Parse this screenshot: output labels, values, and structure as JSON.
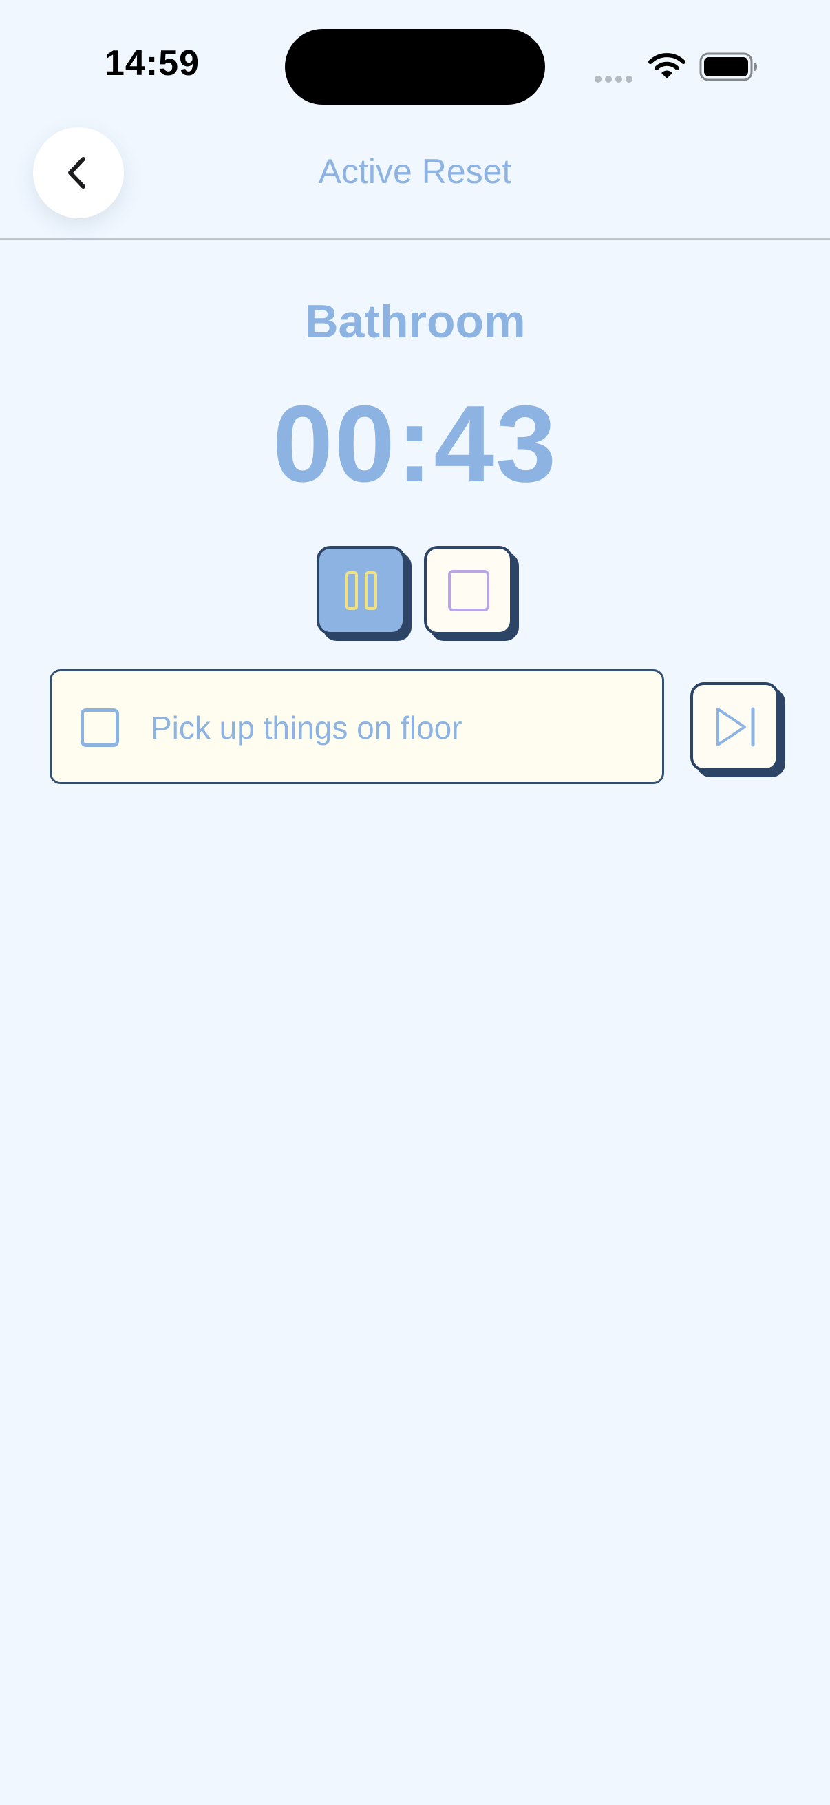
{
  "status_bar": {
    "time": "14:59"
  },
  "header": {
    "title": "Active Reset",
    "back_icon": "chevron-left-icon"
  },
  "session": {
    "room": "Bathroom",
    "timer": "00:43"
  },
  "controls": {
    "pause_icon": "pause-icon",
    "stop_icon": "stop-icon",
    "skip_icon": "skip-forward-icon"
  },
  "task": {
    "label": "Pick up things on floor",
    "checked": false
  },
  "colors": {
    "background": "#f0f7ff",
    "accent": "#8db3e2",
    "outline": "#2c4465",
    "card": "#fffdf0",
    "pause_glyph": "#f2e27e",
    "stop_glyph": "#b9a6e6"
  }
}
